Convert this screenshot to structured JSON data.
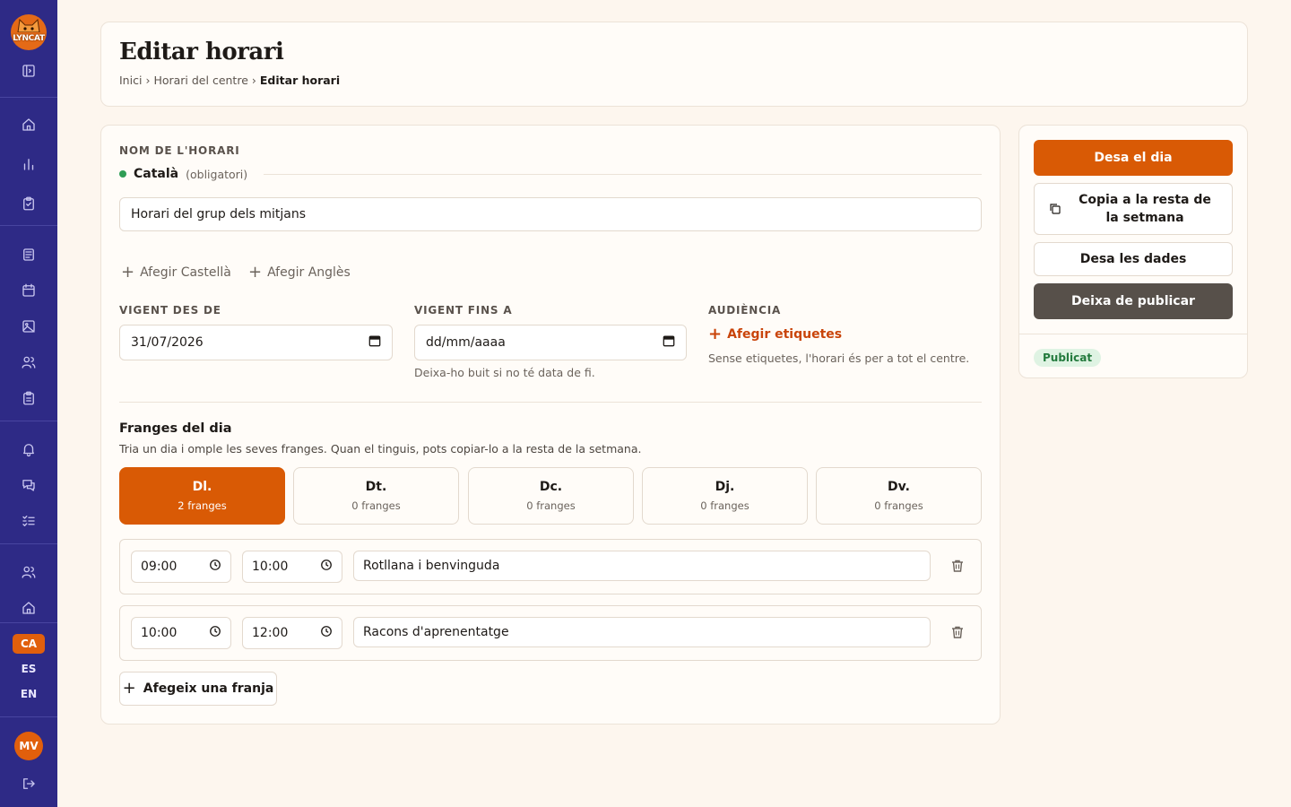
{
  "app": {
    "logo_text": "LYNCAT",
    "brand_color": "#2e2a86",
    "accent_color": "#d95a05"
  },
  "sidebar": {
    "icons": [
      "sidebar-toggle-icon",
      "home-icon",
      "bar-chart-icon",
      "clipboard-check-icon",
      "newspaper-icon",
      "calendar-icon",
      "image-icon",
      "users-icon",
      "clipboard-list-icon",
      "bell-icon",
      "chat-icon",
      "list-check-icon",
      "group-icon",
      "school-icon",
      "logout-icon"
    ],
    "languages": [
      {
        "code": "CA",
        "active": true
      },
      {
        "code": "ES",
        "active": false
      },
      {
        "code": "EN",
        "active": false
      }
    ],
    "user_initials": "MV"
  },
  "header": {
    "title": "Editar horari",
    "breadcrumb": [
      {
        "label": "Inici"
      },
      {
        "label": "Horari del centre"
      },
      {
        "label": "Editar horari"
      }
    ],
    "separator": "›"
  },
  "form": {
    "name_section_label": "Nom de l'horari",
    "language": {
      "name": "Català",
      "required_note": "(obligatori)",
      "status_color": "#2f9d55"
    },
    "name_value": "Horari del grup dels mitjans",
    "add_languages": [
      {
        "label": "Afegir Castellà"
      },
      {
        "label": "Afegir Anglès"
      }
    ],
    "valid_from": {
      "label": "Vigent des de",
      "value": "31/07/2026"
    },
    "valid_until": {
      "label": "Vigent fins a",
      "value": "dd/mm/aaaa",
      "hint": "Deixa-ho buit si no té data de fi."
    },
    "audience": {
      "label": "Audiència",
      "add_label": "Afegir etiquetes",
      "hint": "Sense etiquetes, l'horari és per a tot el centre."
    },
    "slots_section": {
      "title": "Franges del dia",
      "description": "Tria un dia i omple les seves franges. Quan el tinguis, pots copiar-lo a la resta de la setmana."
    },
    "days": [
      {
        "label": "Dl.",
        "count": "2 franges",
        "active": true
      },
      {
        "label": "Dt.",
        "count": "0 franges",
        "active": false
      },
      {
        "label": "Dc.",
        "count": "0 franges",
        "active": false
      },
      {
        "label": "Dj.",
        "count": "0 franges",
        "active": false
      },
      {
        "label": "Dv.",
        "count": "0 franges",
        "active": false
      }
    ],
    "slots": [
      {
        "start": "09:00",
        "end": "10:00",
        "label": "Rotllana i benvinguda"
      },
      {
        "start": "10:00",
        "end": "12:00",
        "label": "Racons d'aprenentatge"
      }
    ],
    "add_slot_label": "Afegeix una franja"
  },
  "actions": {
    "save_day": "Desa el dia",
    "copy_week": "Copia a la resta de la setmana",
    "save_data": "Desa les dades",
    "unpublish": "Deixa de publicar",
    "status_badge": "Publicat"
  }
}
